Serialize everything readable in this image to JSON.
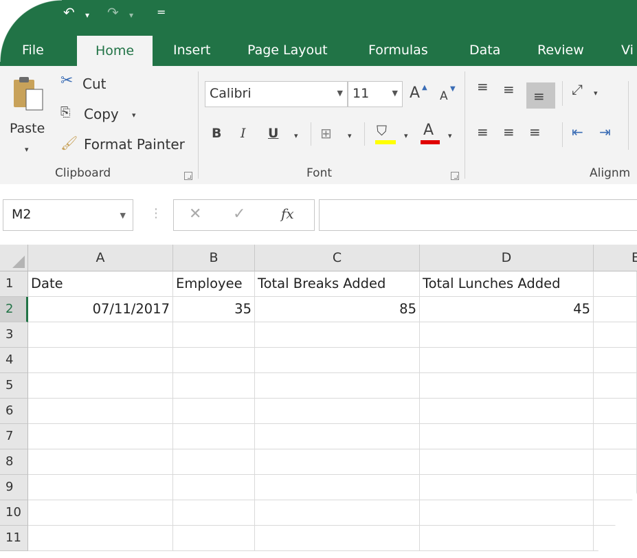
{
  "quick_access": {
    "undo_icon": "undo-icon",
    "redo_icon": "redo-icon",
    "customize": "="
  },
  "tabs": [
    {
      "label": "File"
    },
    {
      "label": "Home"
    },
    {
      "label": "Insert"
    },
    {
      "label": "Page Layout"
    },
    {
      "label": "Formulas"
    },
    {
      "label": "Data"
    },
    {
      "label": "Review"
    },
    {
      "label": "Vi"
    }
  ],
  "ribbon": {
    "clipboard": {
      "paste": "Paste",
      "cut": "Cut",
      "copy": "Copy",
      "format_painter": "Format Painter",
      "group": "Clipboard"
    },
    "font": {
      "name": "Calibri",
      "size": "11",
      "group": "Font",
      "bold": "B",
      "italic": "I",
      "underline": "U",
      "grow": "A",
      "shrink": "A",
      "color_glyph": "A"
    },
    "alignment": {
      "group": "Alignm"
    }
  },
  "formula_bar": {
    "name_box": "M2",
    "cancel": "✕",
    "enter": "✓",
    "fx": "fx",
    "value": ""
  },
  "grid": {
    "columns": [
      "A",
      "B",
      "C",
      "D",
      "E"
    ],
    "rows": [
      "1",
      "2",
      "3",
      "4",
      "5",
      "6",
      "7",
      "8",
      "9",
      "10",
      "11"
    ],
    "cells": {
      "A1": "Date",
      "B1": "Employee",
      "C1": "Total Breaks Added",
      "D1": "Total Lunches Added",
      "A2": "07/11/2017",
      "B2": "35",
      "C2": "85",
      "D2": "45"
    }
  },
  "colors": {
    "accent": "#217346",
    "ribbon": "#f3f3f3",
    "header": "#e6e6e6",
    "font_color": "#e00000",
    "highlight": "#ffff00"
  }
}
